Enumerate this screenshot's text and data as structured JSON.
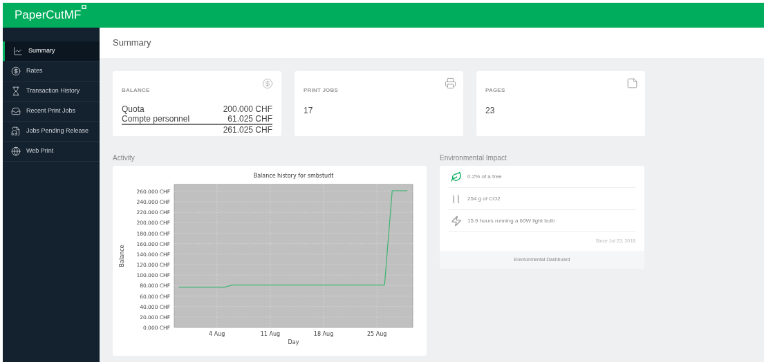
{
  "header": {
    "logo": "PaperCut",
    "logo_suffix": "MF"
  },
  "sidebar": {
    "items": [
      {
        "label": "Summary",
        "selected": true
      },
      {
        "label": "Rates",
        "selected": false
      },
      {
        "label": "Transaction History",
        "selected": false
      },
      {
        "label": "Recent Print Jobs",
        "selected": false
      },
      {
        "label": "Jobs Pending Release",
        "selected": false
      },
      {
        "label": "Web Print",
        "selected": false
      }
    ]
  },
  "page_title": "Summary",
  "balance": {
    "heading": "BALANCE",
    "rows": [
      {
        "label": "Quota",
        "value": "200.000 CHF"
      },
      {
        "label": "Compte personnel",
        "value": "61.025 CHF"
      }
    ],
    "total": "261.025 CHF"
  },
  "print_jobs": {
    "heading": "PRINT JOBS",
    "value": "17"
  },
  "pages": {
    "heading": "PAGES",
    "value": "23"
  },
  "activity": {
    "heading": "Activity",
    "chart_data": {
      "type": "line",
      "title": "Balance history for smbstudt",
      "xlabel": "Day",
      "ylabel": "Balance",
      "categories": [
        null,
        null,
        null,
        null,
        null,
        "4 Aug",
        null,
        null,
        null,
        null,
        null,
        null,
        "11 Aug",
        null,
        null,
        null,
        null,
        null,
        null,
        "18 Aug",
        null,
        null,
        null,
        null,
        null,
        null,
        "25 Aug",
        null,
        null,
        null,
        null
      ],
      "series": [
        {
          "color": "#3cb371",
          "values": [
            77,
            77,
            77,
            77,
            77,
            77,
            77,
            81,
            81,
            81,
            81,
            81,
            81,
            81,
            81,
            81,
            81,
            81,
            81,
            81,
            81,
            81,
            81,
            81,
            81,
            81,
            81,
            81,
            261,
            261,
            261
          ]
        }
      ],
      "ylim": [
        0,
        273
      ],
      "grid": true,
      "yticks": [
        {
          "value": 0,
          "label": "0.000 CHF"
        },
        {
          "value": 20,
          "label": "20.000 CHF"
        },
        {
          "value": 40,
          "label": "40.000 CHF"
        },
        {
          "value": 60,
          "label": "60.000 CHF"
        },
        {
          "value": 80,
          "label": "80.000 CHF"
        },
        {
          "value": 100,
          "label": "100.000 CHF"
        },
        {
          "value": 120,
          "label": "120.000 CHF"
        },
        {
          "value": 140,
          "label": "140.000 CHF"
        },
        {
          "value": 160,
          "label": "160.000 CHF"
        },
        {
          "value": 180,
          "label": "180.000 CHF"
        },
        {
          "value": 200,
          "label": "200.000 CHF"
        },
        {
          "value": 220,
          "label": "220.000 CHF"
        },
        {
          "value": 240,
          "label": "240.000 CHF"
        },
        {
          "value": 260,
          "label": "260.000 CHF"
        }
      ]
    }
  },
  "environment": {
    "heading": "Environmental Impact",
    "items": [
      "0.2% of a tree",
      "254 g of CO2",
      "15.9 hours running a 60W light bulb"
    ],
    "since": "Since Jul 23, 2018",
    "link": "Environmental Dashboard"
  }
}
